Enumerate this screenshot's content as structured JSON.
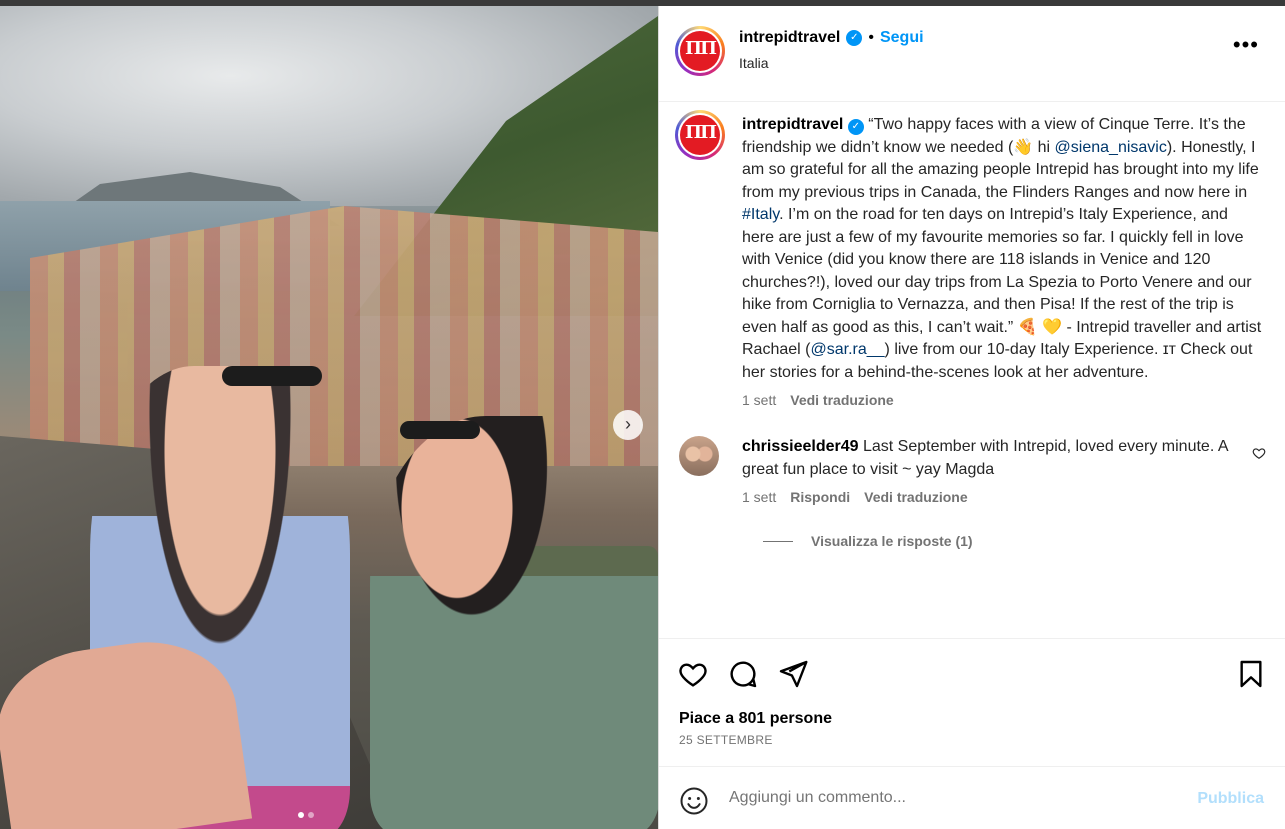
{
  "post": {
    "username": "intrepidtravel",
    "logo_text": "ΠΠ",
    "bullet": "•",
    "follow_label": "Segui",
    "location": "Italia",
    "more_label": "•••"
  },
  "caption": {
    "username": "intrepidtravel",
    "text_1": " “Two happy faces with a view of Cinque Terre. It’s the friendship we didn’t know we needed (👋 hi ",
    "mention_1": "@siena_nisavic",
    "text_2": "). Honestly, I am so grateful for all the amazing people Intrepid has brought into my life from my previous trips in Canada, the Flinders Ranges and now here in ",
    "hashtag": "#Italy",
    "text_3": ".   I’m on the road for ten days on Intrepid’s Italy Experience, and here are just a few of my favourite memories so far. I quickly fell in love with Venice (did you know there are 118 islands in Venice and 120 churches?!), loved our day trips from La Spezia to Porto Venere and our hike from Corniglia to Vernazza, and then Pisa!  If the rest of the trip is even half as good as this, I can’t wait.” 🍕 💛  - Intrepid traveller and artist Rachael (",
    "mention_2": "@sar.ra__",
    "text_4": ") live from our 10-day Italy Experience. ɪᴛ Check out her stories for a behind-the-scenes look at her adventure.",
    "time": "1 sett",
    "translate": "Vedi traduzione"
  },
  "comment": {
    "username": "chrissieelder49",
    "text": " Last September with Intrepid, loved every minute. A great fun place to visit ~ yay Magda",
    "time": "1 sett",
    "reply": "Rispondi",
    "translate": "Vedi traduzione",
    "view_replies": "Visualizza le risposte (1)"
  },
  "engagement": {
    "likes": "Piace a 801 persone",
    "date": "25 SETTEMBRE"
  },
  "composer": {
    "placeholder": "Aggiungi un commento...",
    "post_label": "Pubblica"
  },
  "carousel": {
    "next_arrow": "›"
  }
}
